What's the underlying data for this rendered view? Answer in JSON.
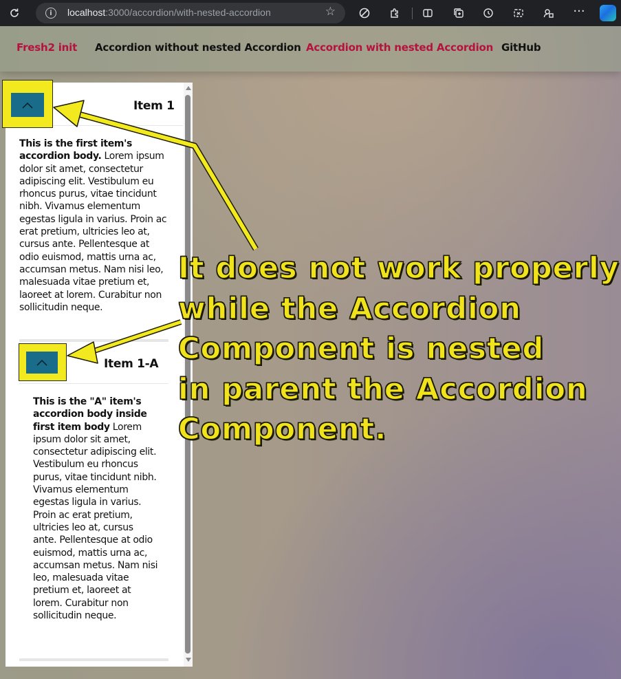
{
  "browser": {
    "url_host": "localhost",
    "url_path": ":3000/accordion/with-nested-accordion"
  },
  "nav": {
    "items": [
      {
        "label": "Fresh2 init",
        "active": true,
        "color": "#b5123e"
      },
      {
        "label": "Accordion without nested Accordion",
        "active": false,
        "color": "#111111"
      },
      {
        "label": "Accordion with nested Accordion",
        "active": true,
        "color": "#b5123e"
      },
      {
        "label": "GitHub",
        "active": false,
        "color": "#111111"
      }
    ]
  },
  "accordion": {
    "item1": {
      "title": "Item 1",
      "body_bold": "This is the first item's accordion body.",
      "body_text": " Lorem ipsum dolor sit amet, consectetur adipiscing elit. Vestibulum eu rhoncus purus, vitae tincidunt nibh. Vivamus elementum egestas ligula in varius. Proin ac erat pretium, ultricies leo at, cursus ante. Pellentesque at odio euismod, mattis urna ac, accumsan metus. Nam nisi leo, malesuada vitae pretium et, laoreet at lorem. Curabitur non sollicitudin neque."
    },
    "item1a": {
      "title": "Item 1-A",
      "body_bold": "This is the \"A\" item's accordion body inside first item body",
      "body_text": " Lorem ipsum dolor sit amet, consectetur adipiscing elit. Vestibulum eu rhoncus purus, vitae tincidunt nibh. Vivamus elementum egestas ligula in varius. Proin ac erat pretium, ultricies leo at, cursus ante. Pellentesque at odio euismod, mattis urna ac, accumsan metus. Nam nisi leo, malesuada vitae pretium et, laoreet at lorem. Curabitur non sollicitudin neque."
    }
  },
  "annotation": {
    "lines": [
      "It does not work properly",
      "while the Accordion",
      "Component is nested",
      "in parent the Accordion",
      "Component."
    ]
  },
  "colors": {
    "toggle_bg": "#1a6d8a",
    "highlight": "#f3e91f",
    "annotation": "#f0e31e",
    "nav_active": "#b5123e"
  },
  "icons": [
    "reload-icon",
    "info-icon",
    "star-icon",
    "tracking-icon",
    "extensions-icon",
    "split-screen-icon",
    "collections-icon",
    "history-icon",
    "screenshot-icon",
    "profile-icon",
    "more-icon",
    "copilot-icon",
    "chevron-up-icon"
  ]
}
